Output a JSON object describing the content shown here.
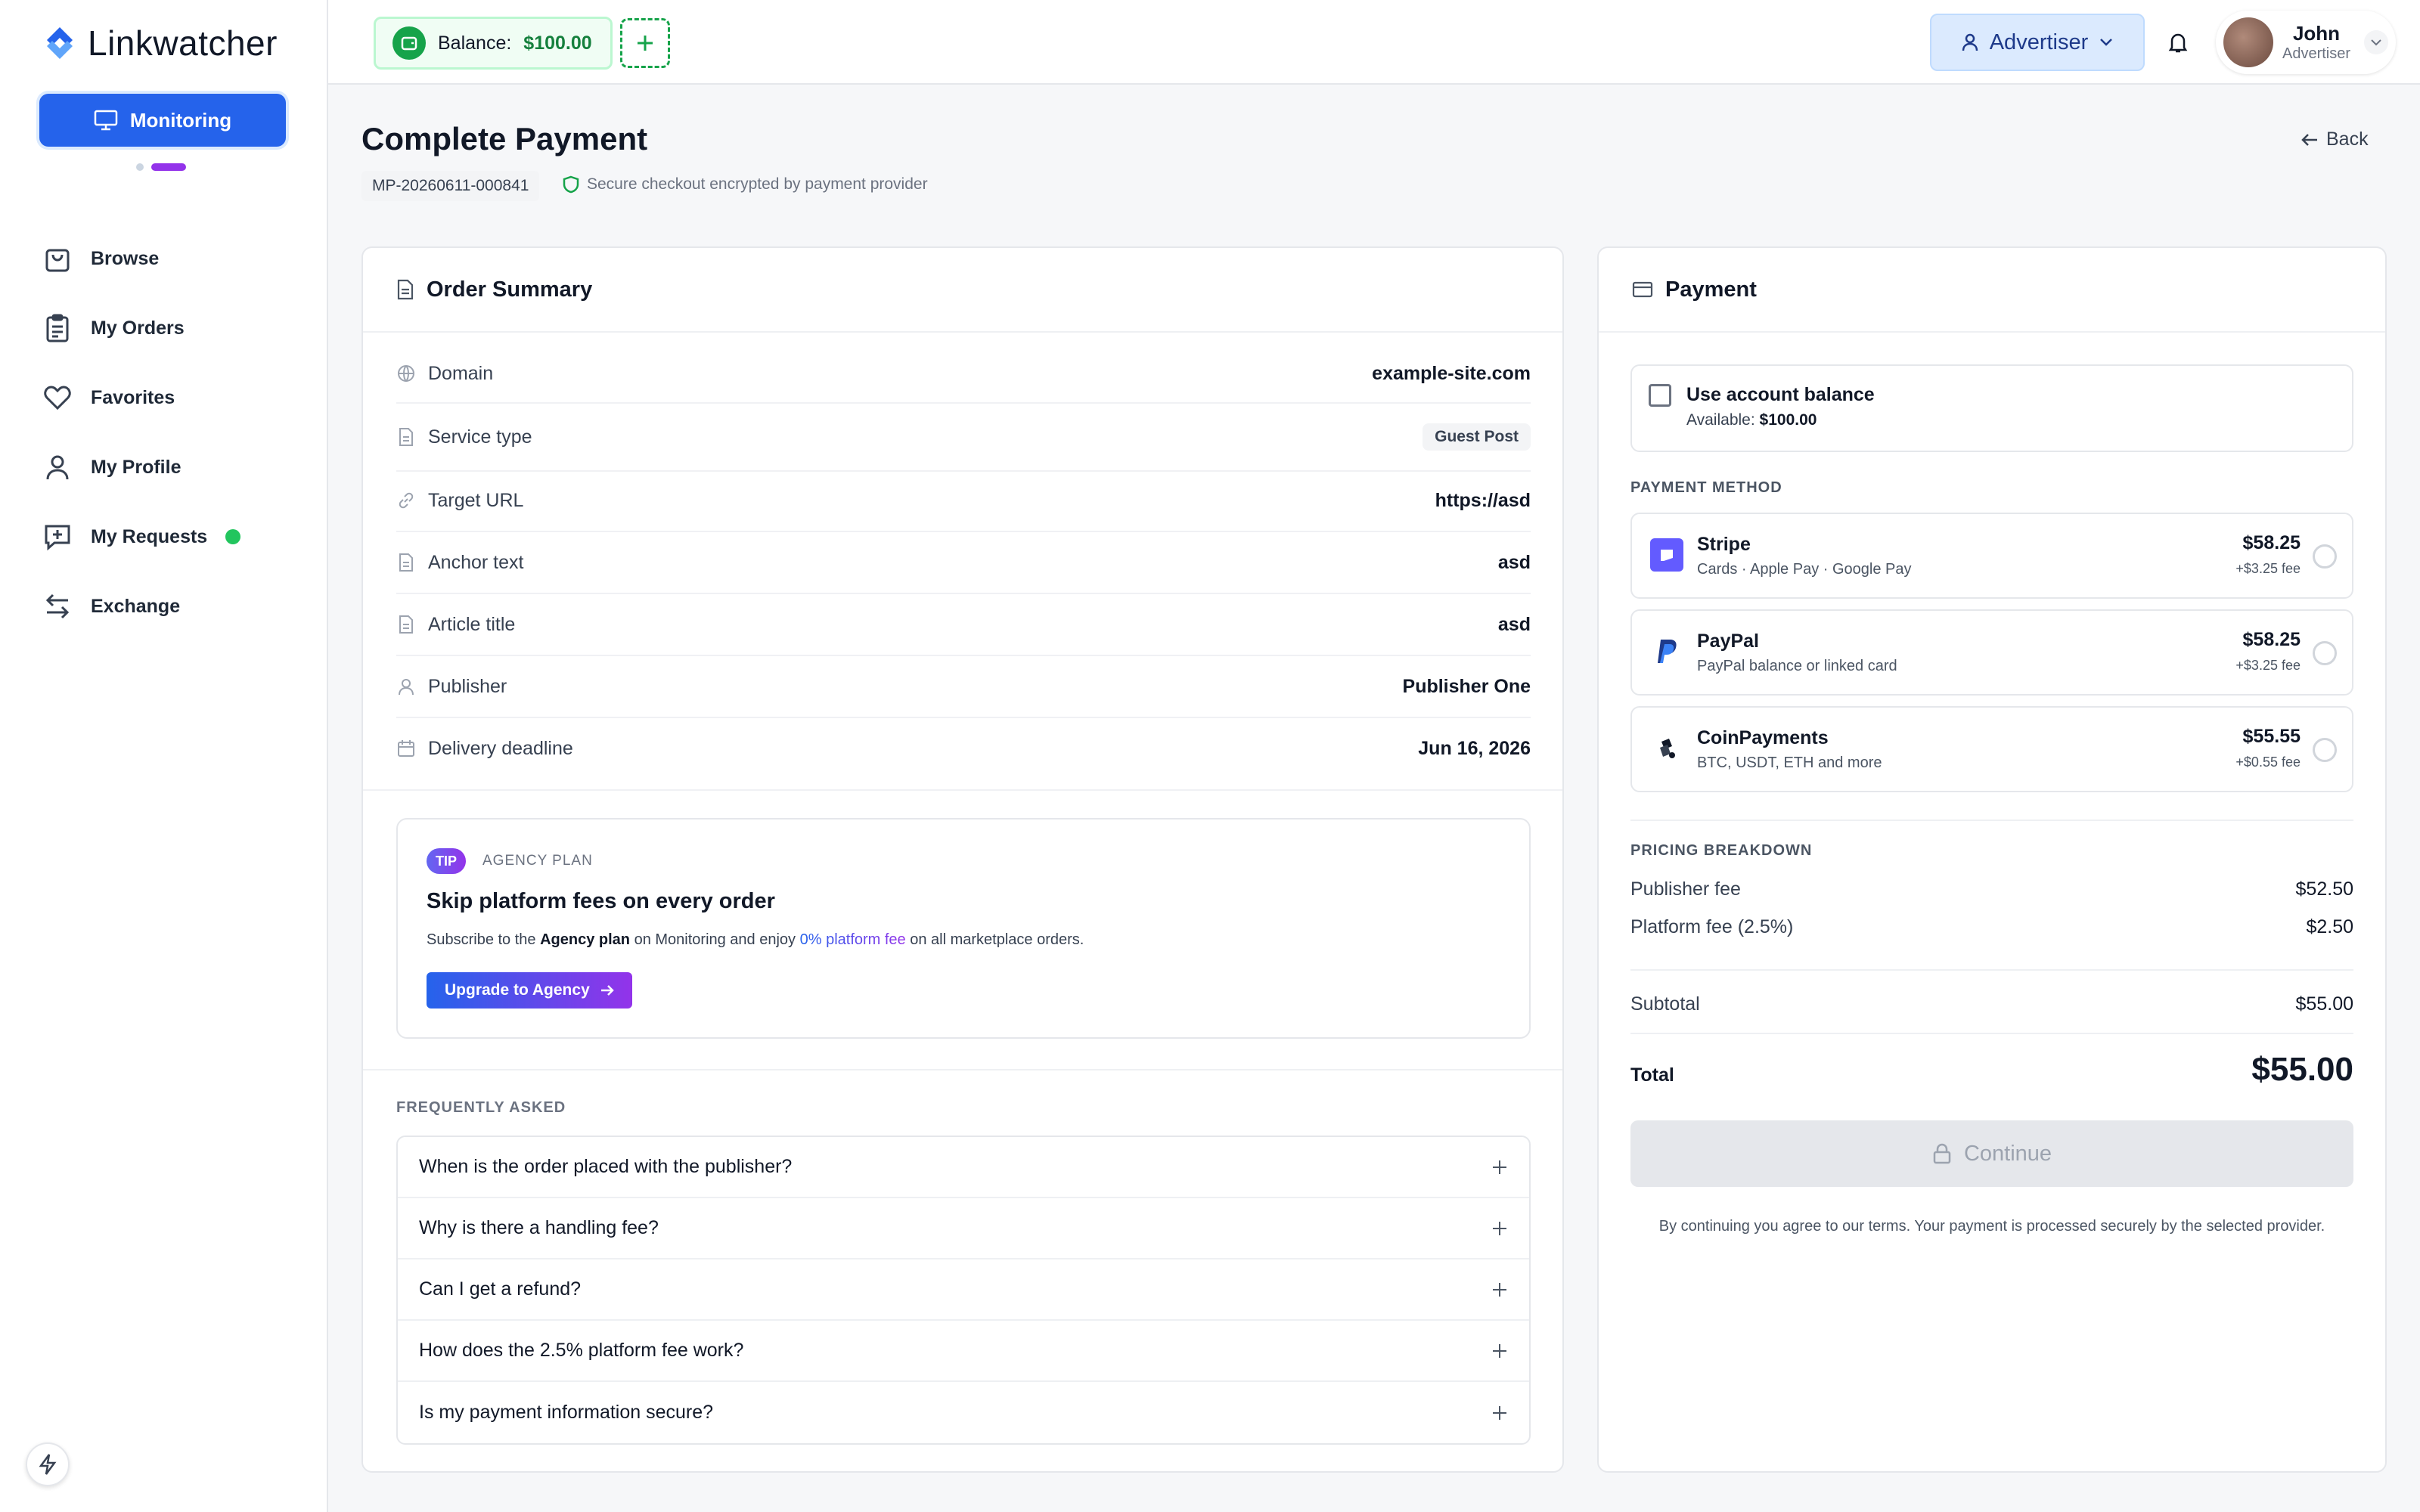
{
  "app": {
    "name": "Linkwatcher"
  },
  "sidebar": {
    "monitor_label": "Monitoring",
    "items": [
      {
        "label": "Browse"
      },
      {
        "label": "My Orders"
      },
      {
        "label": "Favorites"
      },
      {
        "label": "My Profile"
      },
      {
        "label": "My Requests"
      },
      {
        "label": "Exchange"
      }
    ]
  },
  "topbar": {
    "balance_label": "Balance:",
    "balance_value": "$100.00",
    "role": "Advertiser",
    "user_name": "John",
    "user_role": "Advertiser"
  },
  "page": {
    "title": "Complete Payment",
    "order_id": "MP-20260611-000841",
    "secure_text": "Secure checkout encrypted by payment provider",
    "back_label": "Back"
  },
  "summary": {
    "title": "Order Summary",
    "rows": [
      {
        "label": "Domain",
        "value": "example-site.com",
        "icon": "globe-icon"
      },
      {
        "label": "Service type",
        "value": "Guest Post",
        "icon": "document-icon"
      },
      {
        "label": "Target URL",
        "value": "https://asd",
        "icon": "link-icon"
      },
      {
        "label": "Anchor text",
        "value": "asd",
        "icon": "document-icon"
      },
      {
        "label": "Article title",
        "value": "asd",
        "icon": "document-icon"
      },
      {
        "label": "Publisher",
        "value": "Publisher One",
        "icon": "user-icon"
      },
      {
        "label": "Delivery deadline",
        "value": "Jun 16, 2026",
        "icon": "calendar-icon"
      }
    ]
  },
  "tip": {
    "badge": "TIP",
    "plan": "AGENCY PLAN",
    "title": "Skip platform fees on every order",
    "desc_1": "Subscribe to the ",
    "desc_plan": "Agency plan",
    "desc_2": " on Monitoring and enjoy ",
    "desc_fee": "0% platform fee",
    "desc_3": " on all marketplace orders.",
    "button": "Upgrade to Agency"
  },
  "faq": {
    "heading": "FREQUENTLY ASKED",
    "items": [
      "When is the order placed with the publisher?",
      "Why is there a handling fee?",
      "Can I get a refund?",
      "How does the 2.5% platform fee work?",
      "Is my payment information secure?"
    ]
  },
  "payment": {
    "title": "Payment",
    "balance_title": "Use account balance",
    "balance_available_label": "Available:",
    "balance_available_value": "$100.00",
    "method_heading": "PAYMENT METHOD",
    "methods": [
      {
        "name": "Stripe",
        "sub": "Cards · Apple Pay · Google Pay",
        "price": "$58.25",
        "fee": "+$3.25 fee",
        "icon": "stripe-icon"
      },
      {
        "name": "PayPal",
        "sub": "PayPal balance or linked card",
        "price": "$58.25",
        "fee": "+$3.25 fee",
        "icon": "paypal-icon"
      },
      {
        "name": "CoinPayments",
        "sub": "BTC, USDT, ETH and more",
        "price": "$55.55",
        "fee": "+$0.55 fee",
        "icon": "coinpayments-icon"
      }
    ],
    "breakdown_heading": "PRICING BREAKDOWN",
    "breakdown": [
      {
        "label": "Publisher fee",
        "value": "$52.50"
      },
      {
        "label": "Platform fee (2.5%)",
        "value": "$2.50"
      }
    ],
    "subtotal_label": "Subtotal",
    "subtotal_value": "$55.00",
    "total_label": "Total",
    "total_value": "$55.00",
    "continue_label": "Continue",
    "terms": "By continuing you agree to our terms. Your payment is processed securely by the selected provider."
  }
}
